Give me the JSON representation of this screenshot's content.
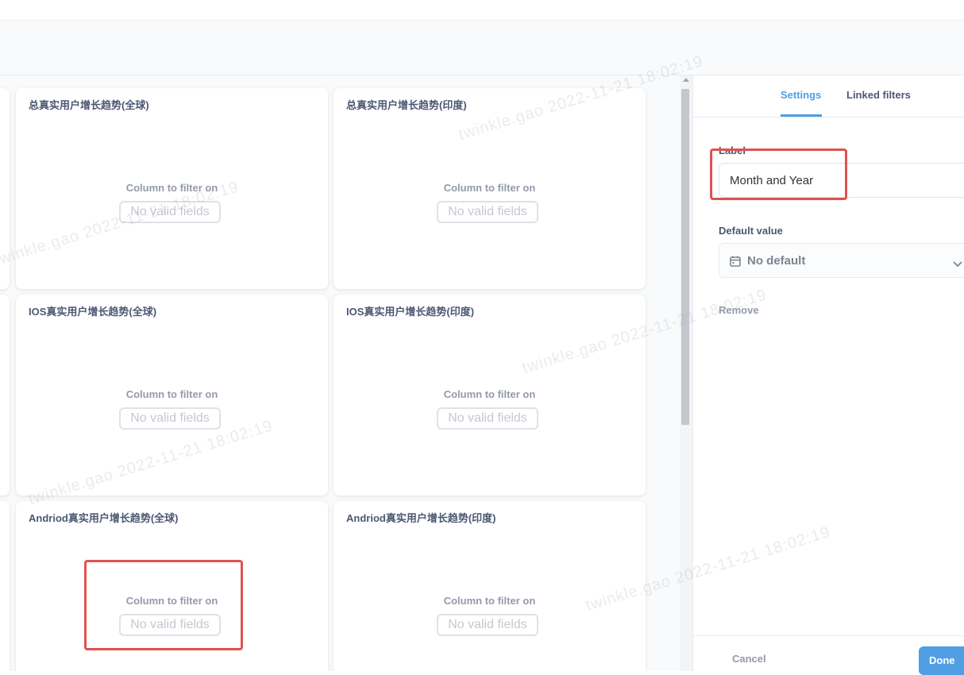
{
  "dashboard": {
    "cards": [
      {
        "title": "总真实用户增长趋势(全球)",
        "filter_label": "Column to filter on",
        "filter_value": "No valid fields"
      },
      {
        "title": "总真实用户增长趋势(印度)",
        "filter_label": "Column to filter on",
        "filter_value": "No valid fields"
      },
      {
        "title": "IOS真实用户增长趋势(全球)",
        "filter_label": "Column to filter on",
        "filter_value": "No valid fields"
      },
      {
        "title": "IOS真实用户增长趋势(印度)",
        "filter_label": "Column to filter on",
        "filter_value": "No valid fields"
      },
      {
        "title": "Andriod真实用户增长趋势(全球)",
        "filter_label": "Column to filter on",
        "filter_value": "No valid fields"
      },
      {
        "title": "Andriod真实用户增长趋势(印度)",
        "filter_label": "Column to filter on",
        "filter_value": "No valid fields"
      }
    ]
  },
  "sidebar": {
    "tabs": [
      {
        "label": "Settings",
        "active": true
      },
      {
        "label": "Linked filters",
        "active": false
      }
    ],
    "label_field": {
      "label": "Label",
      "value": "Month and Year"
    },
    "default_value": {
      "label": "Default value",
      "value": "No default",
      "icon": "calendar-icon"
    },
    "remove_label": "Remove",
    "footer": {
      "cancel_label": "Cancel",
      "done_label": "Done"
    }
  },
  "watermark": {
    "text": "twinkle.gao  2022-11-21  18:02:19"
  },
  "colors": {
    "accent": "#509ee3",
    "highlight": "#e0524f",
    "text": "#4c5773",
    "muted": "#949aab"
  }
}
